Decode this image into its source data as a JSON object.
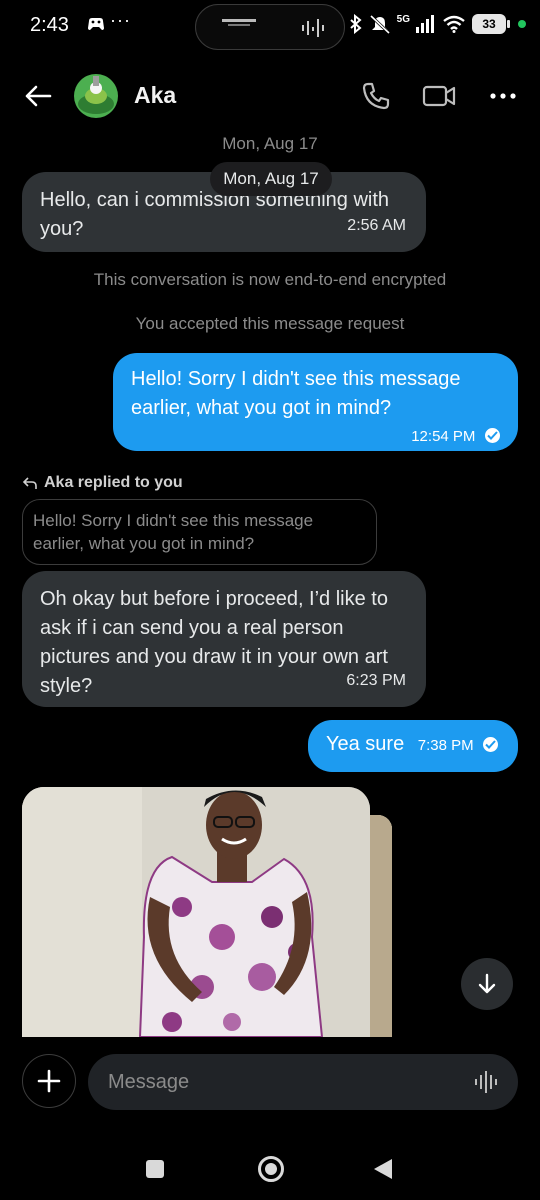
{
  "status_bar": {
    "time": "2:43",
    "overflow_dots": "···",
    "network_label": "5G",
    "battery_level": "33",
    "battery_color": "#e7e7e7",
    "active_indicator_color": "#22c55e",
    "icons": [
      "game-controller-icon",
      "bluetooth-icon",
      "mute-icon",
      "signal-icon",
      "wifi-icon",
      "battery-icon"
    ]
  },
  "header": {
    "contact_name": "Aka",
    "icons": [
      "back-arrow-icon",
      "avatar",
      "phone-icon",
      "video-camera-icon",
      "more-icon"
    ]
  },
  "conversation": {
    "date_label": "Mon, Aug 17",
    "date_pill": "Mon, Aug 17",
    "messages": [
      {
        "direction": "in",
        "text": "Hello, can i commission something with you?",
        "time": "2:56 AM"
      },
      {
        "direction": "system",
        "text": "This conversation is now end-to-end encrypted"
      },
      {
        "direction": "system",
        "text": "You accepted this message request"
      },
      {
        "direction": "out",
        "text": "Hello! Sorry I didn't see this message earlier, what you got in mind?",
        "time": "12:54 PM",
        "status": "read"
      },
      {
        "direction": "in",
        "reply_label": "Aka replied to you",
        "quoted": "Hello! Sorry I didn't see this message earlier, what you got in mind?",
        "text": "Oh okay but before i proceed, I’d like to ask if i can send you a real person pictures and you draw it in your own art style?",
        "time": "6:23 PM"
      },
      {
        "direction": "out",
        "text": "Yea sure",
        "time": "7:38 PM",
        "status": "read"
      },
      {
        "direction": "in",
        "type": "image"
      }
    ],
    "colors": {
      "incoming_bubble": "#2f3336",
      "outgoing_bubble": "#1d9bf0",
      "background": "#000000"
    }
  },
  "composer": {
    "placeholder": "Message",
    "value": ""
  }
}
